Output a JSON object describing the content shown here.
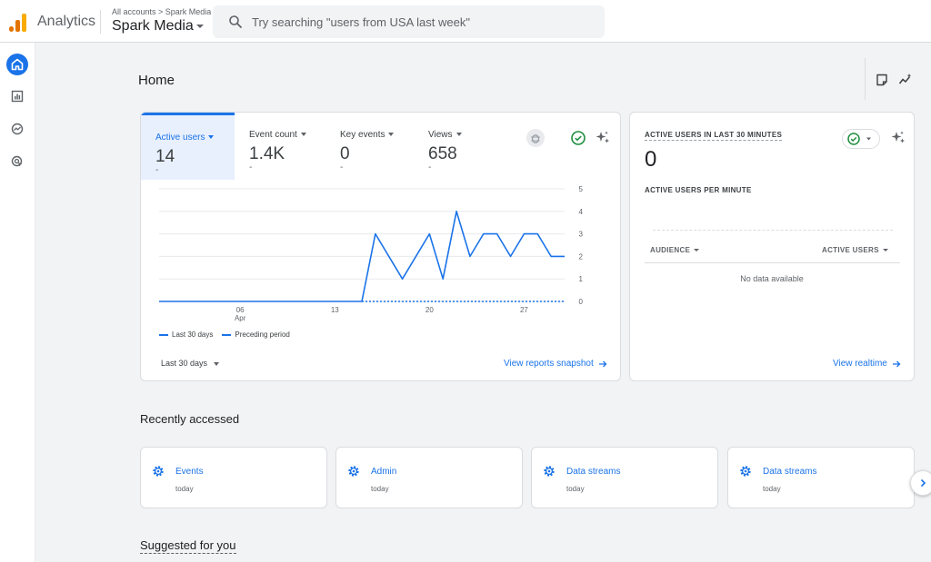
{
  "app": {
    "name": "Analytics"
  },
  "account": {
    "breadcrumb": "All accounts > Spark Media",
    "property": "Spark Media"
  },
  "search": {
    "placeholder": "Try searching \"users from USA last week\""
  },
  "rail": {
    "icons": [
      "home-icon",
      "reports-icon",
      "explore-icon",
      "advertising-icon"
    ]
  },
  "page": {
    "title": "Home"
  },
  "header_icons": [
    "notes-icon",
    "insights-icon"
  ],
  "overview": {
    "metrics": [
      {
        "label": "Active users",
        "value": "14",
        "sub": "-"
      },
      {
        "label": "Event count",
        "value": "1.4K",
        "sub": "-"
      },
      {
        "label": "Key events",
        "value": "0",
        "sub": "-"
      },
      {
        "label": "Views",
        "value": "658",
        "sub": "-"
      }
    ],
    "legend": {
      "current": "Last 30 days",
      "previous": "Preceding period"
    },
    "date_range": "Last 30 days",
    "link": "View reports snapshot"
  },
  "chart_data": {
    "type": "line",
    "x_ticks": [
      "06\nApr",
      "13",
      "20",
      "27"
    ],
    "x_tick_positions": [
      6,
      13,
      20,
      27
    ],
    "ylim": [
      0,
      5
    ],
    "y_ticks": [
      "0",
      "1",
      "2",
      "3",
      "4",
      "5"
    ],
    "grid": true,
    "series": [
      {
        "name": "Last 30 days",
        "style": "solid",
        "x": [
          0,
          15,
          16,
          18,
          20,
          21,
          22,
          23,
          24,
          25,
          26,
          27,
          28,
          29,
          30
        ],
        "values": [
          0,
          0,
          3,
          1,
          3,
          1,
          4,
          2,
          3,
          3,
          2,
          3,
          3,
          2,
          2
        ]
      },
      {
        "name": "Preceding period",
        "style": "dashed",
        "x": [
          15,
          30
        ],
        "values": [
          0,
          0
        ]
      }
    ],
    "colors": {
      "line": "#1a73e8"
    }
  },
  "realtime": {
    "title": "ACTIVE USERS IN LAST 30 MINUTES",
    "value": "0",
    "subtitle": "ACTIVE USERS PER MINUTE",
    "columns": [
      "AUDIENCE",
      "ACTIVE USERS"
    ],
    "empty": "No data available",
    "link": "View realtime"
  },
  "recent": {
    "title": "Recently accessed",
    "items": [
      {
        "label": "Events",
        "sub": "today"
      },
      {
        "label": "Admin",
        "sub": "today"
      },
      {
        "label": "Data streams",
        "sub": "today"
      },
      {
        "label": "Data streams",
        "sub": "today"
      }
    ]
  },
  "suggested": {
    "title": "Suggested for you"
  },
  "colors": {
    "accent": "#1a73e8",
    "logo_orange": "#e37400",
    "logo_yellow": "#f9ab00",
    "success": "#1e8e3e"
  }
}
